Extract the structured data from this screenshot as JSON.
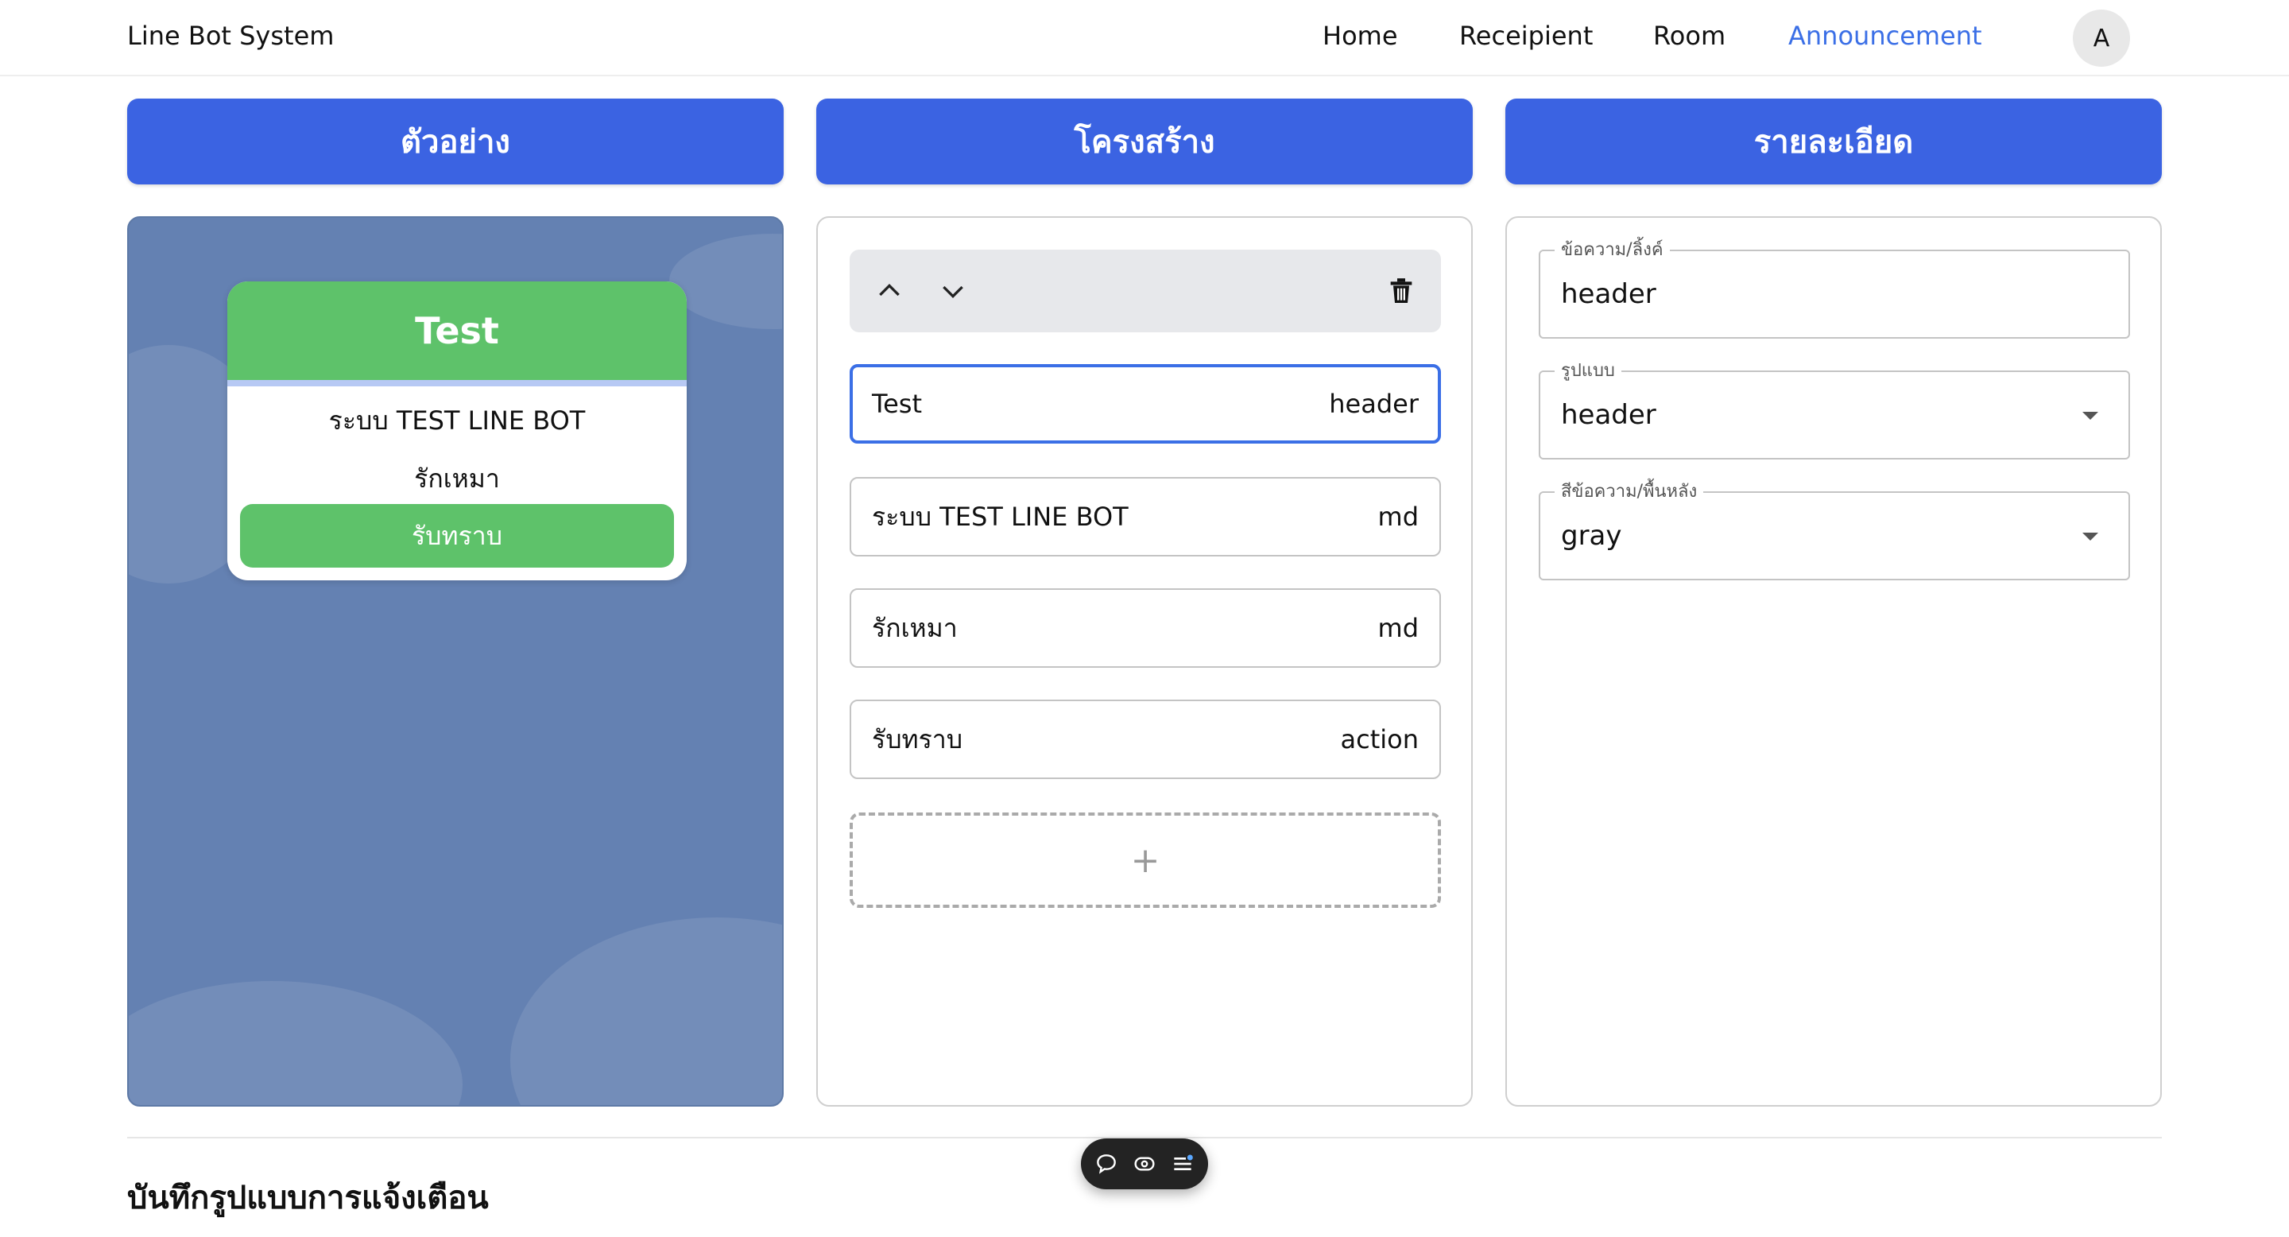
{
  "navbar": {
    "brand": "Line Bot System",
    "links": [
      "Home",
      "Receipient",
      "Room",
      "Announcement"
    ],
    "active_link": "Announcement",
    "avatar_initial": "A"
  },
  "sections": [
    "ตัวอย่าง",
    "โครงสร้าง",
    "รายละเอียด"
  ],
  "preview": {
    "header": "Test",
    "lines": [
      "ระบบ TEST LINE BOT",
      "รักเหมา"
    ],
    "action": "รับทราบ"
  },
  "structure": {
    "toolbar_icons": [
      "chevron-up-icon",
      "chevron-down-icon",
      "trash-icon"
    ],
    "rows": [
      {
        "text": "Test",
        "type": "header",
        "selected": true
      },
      {
        "text": "ระบบ TEST LINE BOT",
        "type": "md",
        "selected": false
      },
      {
        "text": "รักเหมา",
        "type": "md",
        "selected": false
      },
      {
        "text": "รับทราบ",
        "type": "action",
        "selected": false
      }
    ],
    "add_label": "+"
  },
  "details": {
    "fields": [
      {
        "label": "ข้อความ/ลิ้งค์",
        "value": "header",
        "kind": "text"
      },
      {
        "label": "รูปแบบ",
        "value": "header",
        "kind": "select"
      },
      {
        "label": "สีข้อความ/พื้นหลัง",
        "value": "gray",
        "kind": "select"
      }
    ]
  },
  "footer": {
    "heading": "บันทึกรูปแบบการแจ้งเตือน"
  },
  "floating_toolbar": {
    "icons": [
      "chat-bubble-icon",
      "eye-icon",
      "menu-list-icon"
    ]
  },
  "colors": {
    "primary": "#3b63e2",
    "active_link": "#3b6fe6",
    "line_green": "#5ec26a",
    "preview_bg": "#6481b2"
  }
}
